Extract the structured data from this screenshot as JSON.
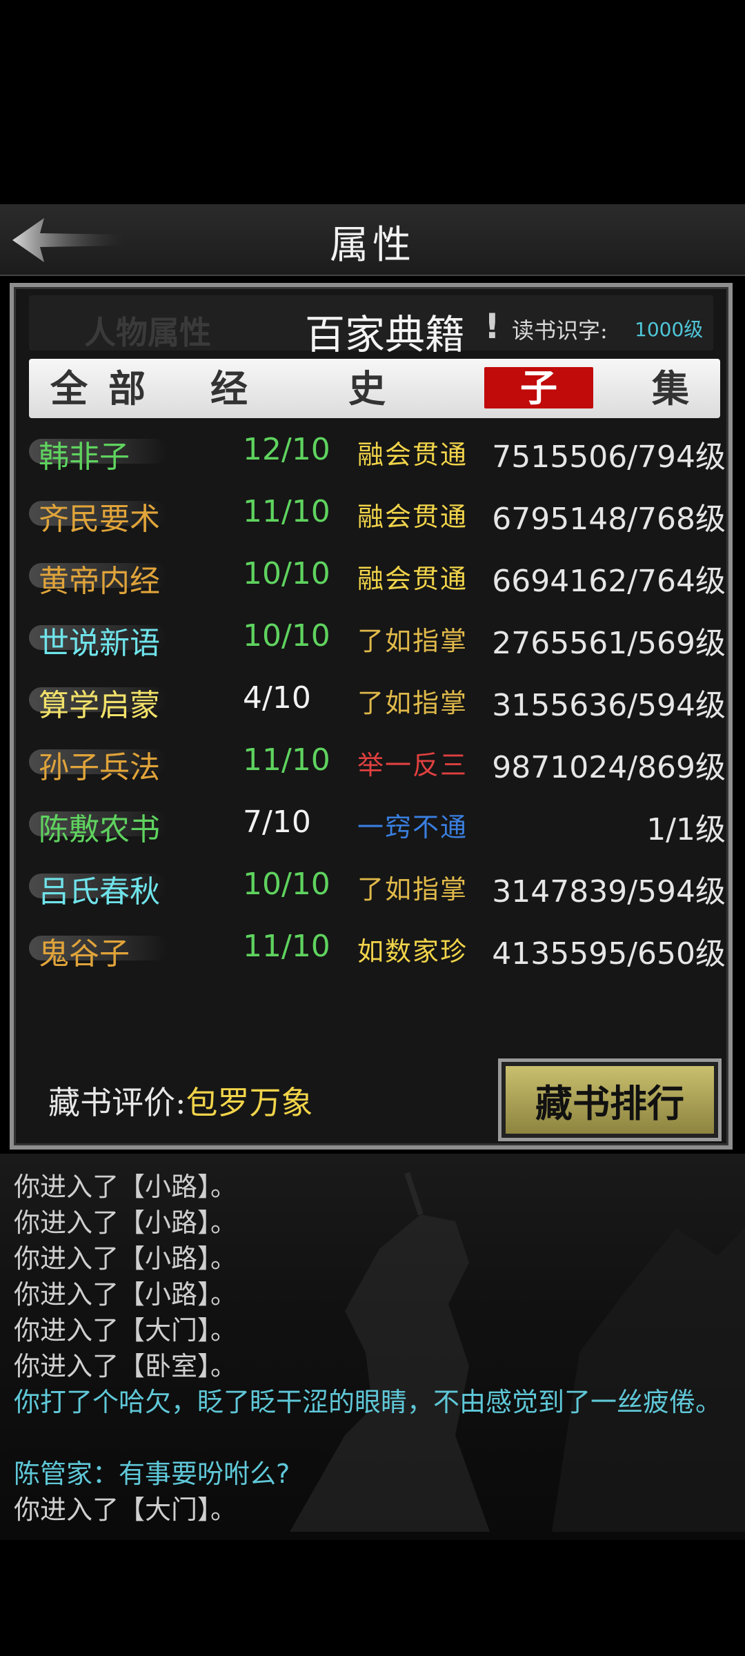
{
  "header": {
    "title": "属性"
  },
  "panel": {
    "ghost_tab": "人物属性",
    "title": "百家典籍",
    "info": "!",
    "literacy_label": "读书识字:",
    "literacy_value": "1000级"
  },
  "tabs": [
    {
      "label": "全部",
      "active": false
    },
    {
      "label": "经",
      "active": false
    },
    {
      "label": "史",
      "active": false
    },
    {
      "label": "子",
      "active": true
    },
    {
      "label": "集",
      "active": false
    }
  ],
  "books": [
    {
      "name": "韩非子",
      "name_color": "#5fd35f",
      "progress": "12/10",
      "progress_color": "#5fd35f",
      "level": "融会贯通",
      "level_color": "#f1d44a",
      "exp": "7515506/794级"
    },
    {
      "name": "齐民要术",
      "name_color": "#e0a43a",
      "progress": "11/10",
      "progress_color": "#5fd35f",
      "level": "融会贯通",
      "level_color": "#f1d44a",
      "exp": "6795148/768级"
    },
    {
      "name": "黄帝内经",
      "name_color": "#e0a43a",
      "progress": "10/10",
      "progress_color": "#5fd35f",
      "level": "融会贯通",
      "level_color": "#f1d44a",
      "exp": "6694162/764级"
    },
    {
      "name": "世说新语",
      "name_color": "#6fe3ea",
      "progress": "10/10",
      "progress_color": "#5fd35f",
      "level": "了如指掌",
      "level_color": "#e0b94a",
      "exp": "2765561/569级"
    },
    {
      "name": "算学启蒙",
      "name_color": "#f1e16a",
      "progress": "4/10",
      "progress_color": "#f2f2f2",
      "level": "了如指掌",
      "level_color": "#e0b94a",
      "exp": "3155636/594级"
    },
    {
      "name": "孙子兵法",
      "name_color": "#e0a43a",
      "progress": "11/10",
      "progress_color": "#5fd35f",
      "level": "举一反三",
      "level_color": "#e04040",
      "exp": "9871024/869级"
    },
    {
      "name": "陈敷农书",
      "name_color": "#5fd35f",
      "progress": "7/10",
      "progress_color": "#f2f2f2",
      "level": "一窍不通",
      "level_color": "#3a7fe0",
      "exp": "1/1级"
    },
    {
      "name": "吕氏春秋",
      "name_color": "#6fe3ea",
      "progress": "10/10",
      "progress_color": "#5fd35f",
      "level": "了如指掌",
      "level_color": "#e0b94a",
      "exp": "3147839/594级"
    },
    {
      "name": "鬼谷子",
      "name_color": "#e0a43a",
      "progress": "11/10",
      "progress_color": "#5fd35f",
      "level": "如数家珍",
      "level_color": "#f1d44a",
      "exp": "4135595/650级"
    }
  ],
  "evaluation": {
    "label": "藏书评价:",
    "value": "包罗万象"
  },
  "rank_button": "藏书排行",
  "log": [
    {
      "text": "你进入了【小路】。",
      "color": "#cfcfcf"
    },
    {
      "text": "你进入了【小路】。",
      "color": "#cfcfcf"
    },
    {
      "text": "你进入了【小路】。",
      "color": "#cfcfcf"
    },
    {
      "text": "你进入了【小路】。",
      "color": "#cfcfcf"
    },
    {
      "text": "你进入了【大门】。",
      "color": "#cfcfcf"
    },
    {
      "text": "你进入了【卧室】。",
      "color": "#cfcfcf"
    },
    {
      "text": "你打了个哈欠，眨了眨干涩的眼睛，不由感觉到了一丝疲倦。",
      "color": "#5fc8d8"
    },
    {
      "text": "陈管家：有事要吩咐么?",
      "color": "#5fc8d8"
    },
    {
      "text": "你进入了【大门】。",
      "color": "#cfcfcf"
    }
  ]
}
